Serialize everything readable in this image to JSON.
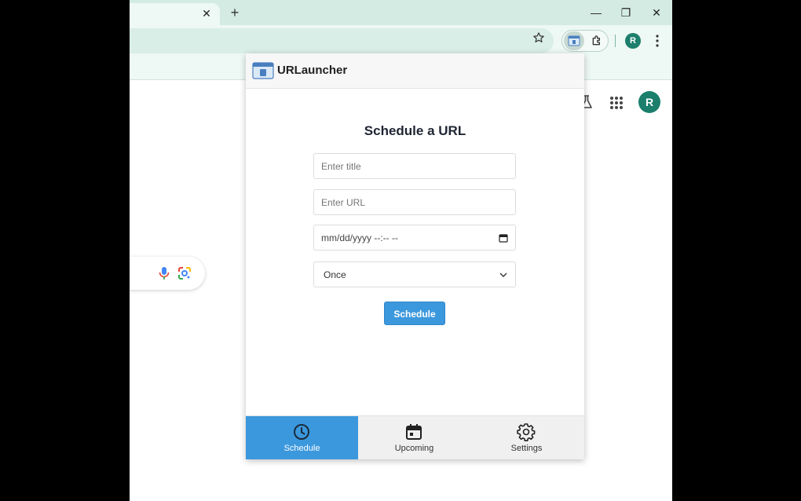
{
  "browser": {
    "avatar_initial": "R"
  },
  "page": {
    "avatar_initial": "R"
  },
  "popup": {
    "app_name": "URLauncher",
    "form": {
      "title": "Schedule a URL",
      "title_placeholder": "Enter title",
      "url_placeholder": "Enter URL",
      "datetime_placeholder": "mm/dd/yyyy --:-- --",
      "repeat_selected": "Once",
      "submit_label": "Schedule"
    },
    "nav": [
      {
        "label": "Schedule",
        "icon": "clock-icon",
        "active": true
      },
      {
        "label": "Upcoming",
        "icon": "calendar-icon",
        "active": false
      },
      {
        "label": "Settings",
        "icon": "gear-icon",
        "active": false
      }
    ],
    "accent_color": "#3c98dd"
  }
}
